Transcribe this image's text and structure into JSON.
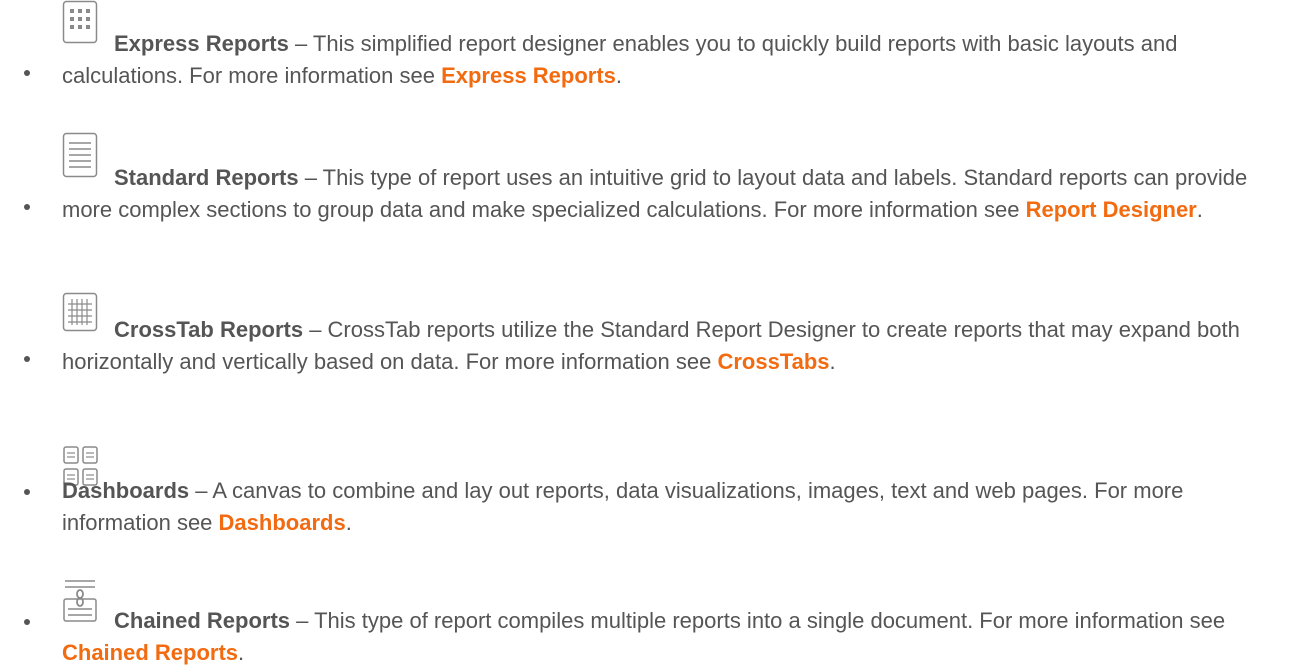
{
  "items": [
    {
      "icon": "express-report-grid-icon",
      "title": "Express Reports",
      "dash": " – ",
      "text": "This simplified report designer enables you to quickly build reports with basic layouts and calculations. For more information see ",
      "link": "Express Reports",
      "end": "."
    },
    {
      "icon": "standard-report-lines-icon",
      "title": "Standard Reports",
      "dash": " – ",
      "text": "This type of report uses an intuitive grid to layout data and labels. Standard reports can provide more complex sections to group data and make specialized calculations. For more information see ",
      "link": "Report Designer",
      "end": "."
    },
    {
      "icon": "crosstab-table-icon",
      "title": "CrossTab Reports",
      "dash": " – ",
      "text": "CrossTab reports utilize the Standard Report Designer to create reports that may expand both horizontally and vertically based on data. For more information see ",
      "link": "CrossTabs",
      "end": "."
    },
    {
      "icon": "dashboard-tiles-icon",
      "title": "Dashboards",
      "dash": " – ",
      "text": "A canvas to combine and lay out reports, data visualizations, images, text and web pages. For more information see ",
      "link": "Dashboards",
      "end": "."
    },
    {
      "icon": "chained-report-icon",
      "title": "Chained Reports",
      "dash": " – ",
      "text": "This type of report compiles multiple reports into a single document. For more information see ",
      "link": "Chained Reports",
      "end": "."
    }
  ],
  "colors": {
    "text": "#555555",
    "link": "#f26b10"
  }
}
